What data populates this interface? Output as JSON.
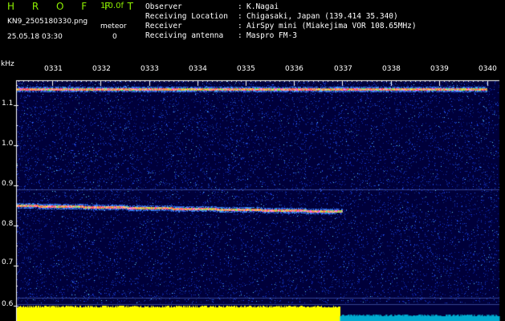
{
  "header": {
    "app_title": "H R O F F T",
    "version": "1.0.0f",
    "filename": "KN9_2505180330.png",
    "meteor_label": "meteor",
    "meteor_count": "0",
    "datetime": "25.05.18 03:30"
  },
  "info": [
    {
      "label": "Observer",
      "value": "K.Nagai"
    },
    {
      "label": "Receiving Location",
      "value": "Chigasaki, Japan (139.414 35.340)"
    },
    {
      "label": "Receiver",
      "value": "AirSpy mini (Miakejima VOR 108.65MHz)"
    },
    {
      "label": "Receiving antenna",
      "value": "Maspro FM-3"
    }
  ],
  "info_separator": ":",
  "chart_data": {
    "type": "heatmap",
    "ylabel": "kHz",
    "y_ticks": [
      "1.1",
      "1.0",
      "0.9",
      "0.8",
      "0.7",
      "0.6"
    ],
    "x_ticks": [
      "0331",
      "0332",
      "0333",
      "0334",
      "0335",
      "0336",
      "0337",
      "0338",
      "0339",
      "0340"
    ],
    "ylim": [
      0.6,
      1.15
    ],
    "signals": [
      {
        "freq_khz": 1.14,
        "start": "0330",
        "end": "0340"
      },
      {
        "freq_khz": 0.85,
        "start": "0330",
        "end": "0337"
      }
    ],
    "colors": {
      "background": "#00003a",
      "noise": "#1a3ad8",
      "signal": "#ff4040",
      "level_high": "#ffff00",
      "level_low": "#00e0ff",
      "axis": "#ffffff",
      "title": "#8ef000"
    }
  }
}
